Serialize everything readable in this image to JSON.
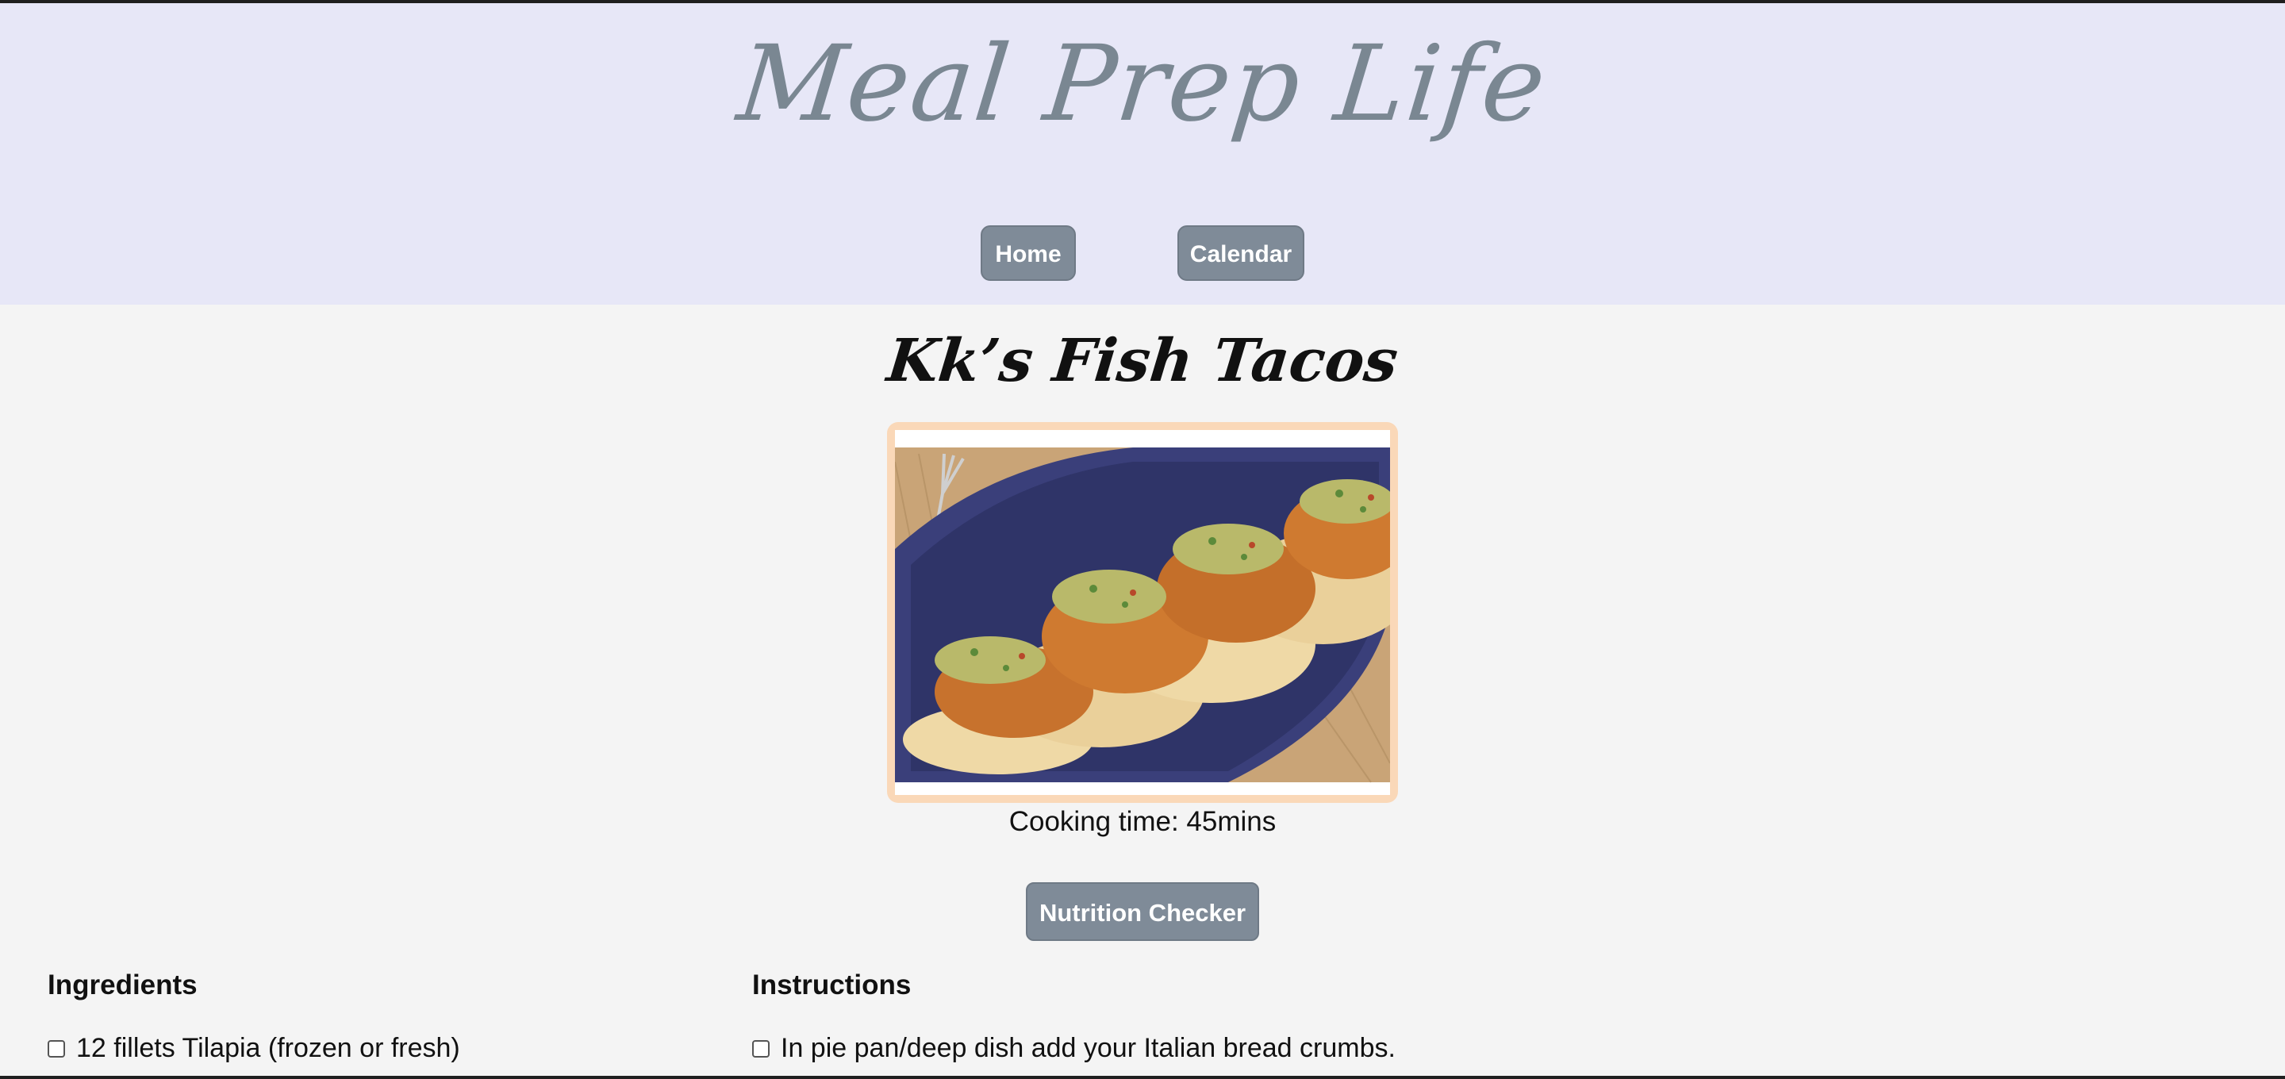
{
  "header": {
    "brand": "Meal Prep Life",
    "nav": {
      "home": "Home",
      "calendar": "Calendar"
    }
  },
  "recipe": {
    "title": "Kk’s Fish Tacos",
    "image_icon": "fish-tacos-photo",
    "cooking_time": "Cooking time: 45mins",
    "nutrition_button": "Nutrition Checker"
  },
  "ingredients": {
    "heading": "Ingredients",
    "items": [
      "12 fillets Tilapia (frozen or fresh)"
    ]
  },
  "instructions": {
    "heading": "Instructions",
    "items": [
      "In pie pan/deep dish add your Italian bread crumbs."
    ]
  },
  "colors": {
    "header_bg": "#e7e7f7",
    "brand_text": "#7a8792",
    "button_bg": "#7f8b98",
    "image_border": "#fad8b8",
    "page_bg": "#f4f4f4"
  }
}
